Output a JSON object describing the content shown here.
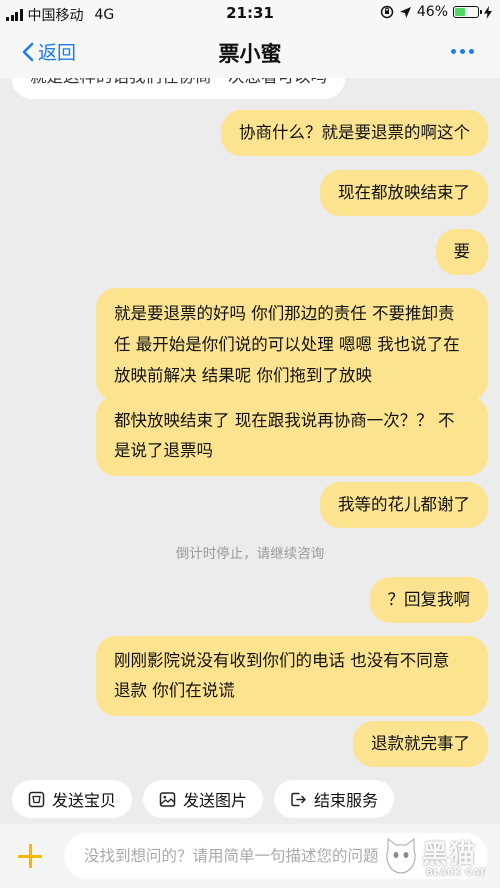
{
  "status_bar": {
    "carrier": "中国移动",
    "network": "4G",
    "time": "21:31",
    "battery_percent": "46%",
    "battery_level": 0.46
  },
  "nav": {
    "back_label": "返回",
    "title": "票小蜜"
  },
  "messages": [
    {
      "side": "left",
      "text": "就是这样的话我们在协商一次您看可以吗"
    },
    {
      "side": "right",
      "text": "协商什么？就是要退票的啊这个"
    },
    {
      "side": "right",
      "text": "现在都放映结束了"
    },
    {
      "side": "right",
      "text": "要"
    },
    {
      "side": "right",
      "lines": [
        "就是要退票的好吗 你们那边的责任 不要推卸责",
        "任 最开始是你们说的可以处理 嗯嗯 我也说了在",
        "放映前解决 结果呢 你们拖到了放映"
      ]
    },
    {
      "side": "right",
      "lines": [
        "都快放映结束了 现在跟我说再协商一次？？ 不",
        "是说了退票吗"
      ]
    },
    {
      "side": "right",
      "text": "我等的花儿都谢了"
    },
    {
      "side": "system",
      "text": "倒计时停止，请继续咨询"
    },
    {
      "side": "right",
      "text": "？回复我啊"
    },
    {
      "side": "right",
      "lines": [
        "刚刚影院说没有收到你们的电话 也没有不同意",
        "退款 你们在说谎"
      ]
    },
    {
      "side": "right",
      "text": "退款就完事了"
    }
  ],
  "quick_actions": [
    {
      "label": "发送宝贝",
      "icon": "send-item-icon"
    },
    {
      "label": "发送图片",
      "icon": "image-icon"
    },
    {
      "label": "结束服务",
      "icon": "end-service-icon"
    }
  ],
  "input": {
    "placeholder": "没找到想问的？请用简单一句描述您的问题"
  },
  "watermark": {
    "text": "黑猫",
    "sub": "BLACK CAT"
  },
  "colors": {
    "accent": "#1a7cf0",
    "user_bubble": "#fbe390",
    "plus": "#f5b700"
  }
}
